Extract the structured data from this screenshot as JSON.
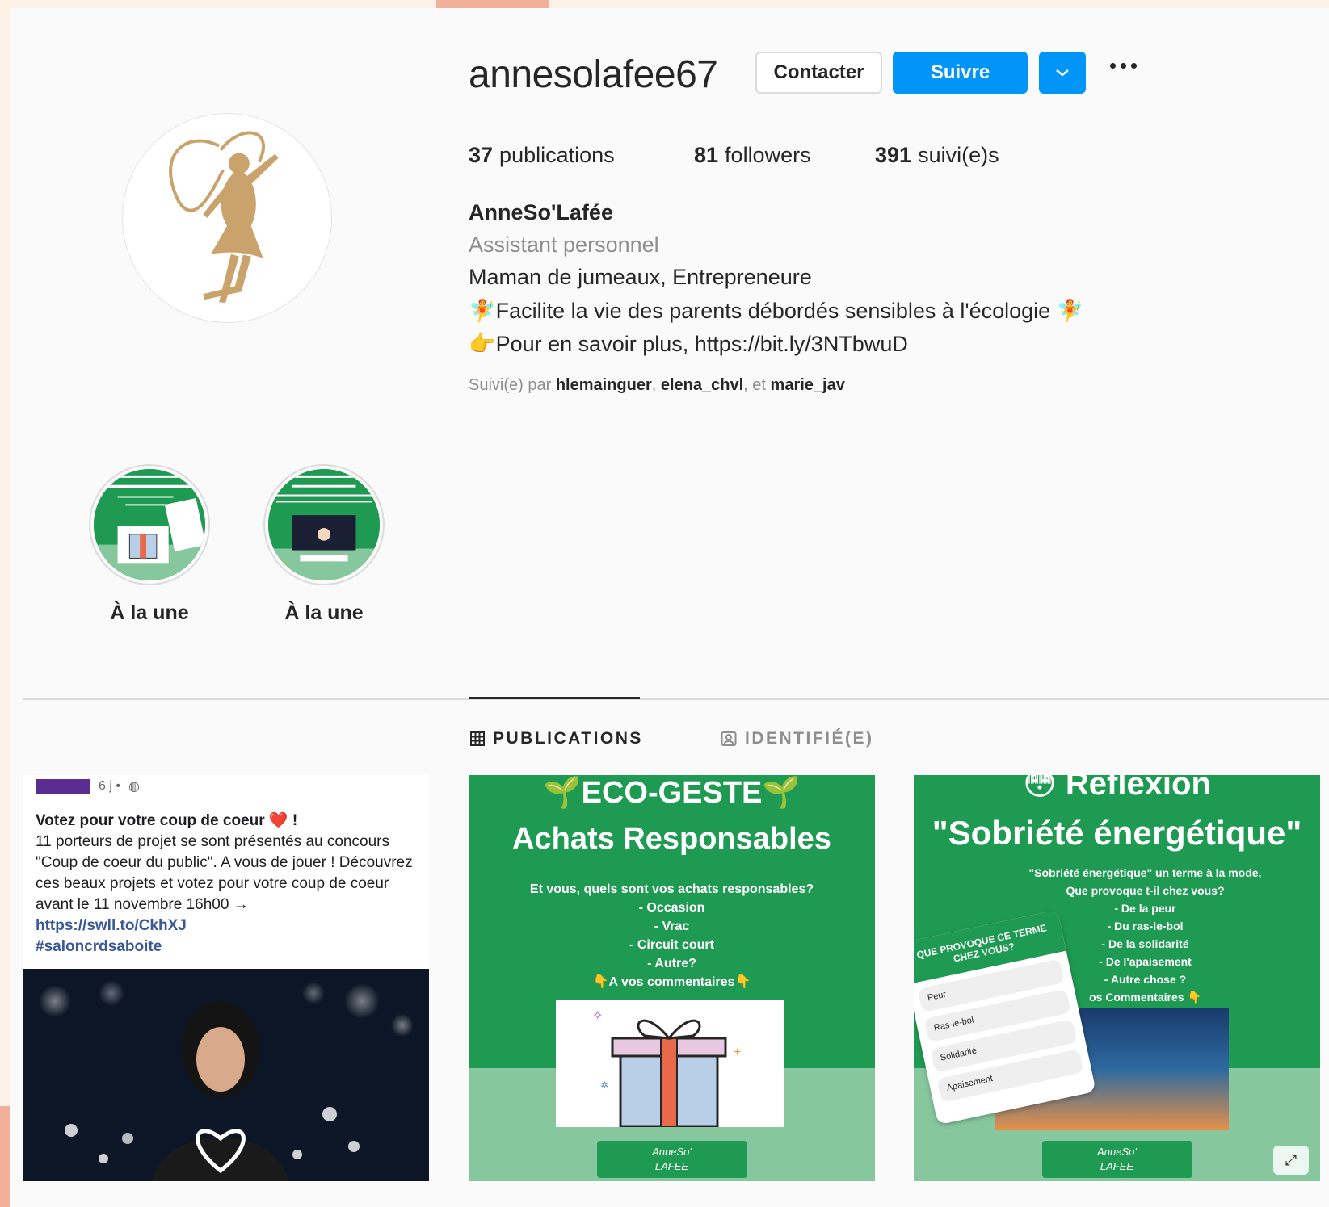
{
  "profile": {
    "username": "annesolafee67",
    "contact_label": "Contacter",
    "follow_label": "Suivre",
    "stats": {
      "posts_count": "37",
      "posts_label": "publications",
      "followers_count": "81",
      "followers_label": "followers",
      "following_count": "391",
      "following_label": "suivi(e)s"
    },
    "full_name": "AnneSo'Lafée",
    "category": "Assistant personnel",
    "bio_line1": "Maman de jumeaux, Entrepreneure",
    "bio_line2": "🧚Facilite la vie des parents débordés sensibles à l'écologie 🧚",
    "bio_line3": "👉Pour en savoir plus, https://bit.ly/3NTbwuD",
    "followed_by_prefix": "Suivi(e) par",
    "followed_by": [
      "hlemainguer",
      "elena_chvl",
      "marie_jav"
    ],
    "followed_by_and": "et"
  },
  "highlights": [
    {
      "label": "À la une"
    },
    {
      "label": "À la une"
    }
  ],
  "tabs": {
    "publications": "PUBLICATIONS",
    "tagged": "IDENTIFIÉ(E)"
  },
  "posts": [
    {
      "time": "6 j •",
      "title": "Votez pour votre coup de coeur ❤️ !",
      "text": "11 porteurs de projet se sont présentés au concours \"Coup de coeur du public\". A vous de jouer ! Découvrez ces beaux projets et votez pour votre coup de coeur avant le 11 novembre 16h00 →",
      "link": "https://swll.to/CkhXJ",
      "hashtag": "#saloncrdsaboite"
    },
    {
      "heading1": "🌱ECO-GESTE🌱",
      "heading2": "Achats Responsables",
      "lines": [
        "Et vous, quels sont vos achats responsables?",
        "- Occasion",
        "- Vrac",
        "- Circuit court",
        "- Autre?",
        "👇A vos commentaires👇"
      ],
      "brand": [
        "AnneSo'",
        "LAFEE"
      ]
    },
    {
      "heading1": "😳 Reflexion",
      "heading2": "\"Sobriété énergétique\"",
      "lines": [
        "\"Sobriété énergétique\" un terme à la mode,",
        "Que provoque t-il chez vous?",
        "- De la peur",
        "- Du ras-le-bol",
        "- De la solidarité",
        "- De l'apaisement",
        "- Autre chose ?",
        "os Commentaires 👇"
      ],
      "poll_title": "QUE PROVOQUE CE TERME CHEZ VOUS?",
      "poll_options": [
        "Peur",
        "Ras-le-bol",
        "Solidarité",
        "Apaisement"
      ],
      "brand": [
        "AnneSo'",
        "LAFEE"
      ]
    }
  ],
  "colors": {
    "accent": "#0095f6",
    "post_green": "#1f9a52",
    "post_light_green": "#86c79e",
    "fairy_gold": "#c9a36b"
  }
}
